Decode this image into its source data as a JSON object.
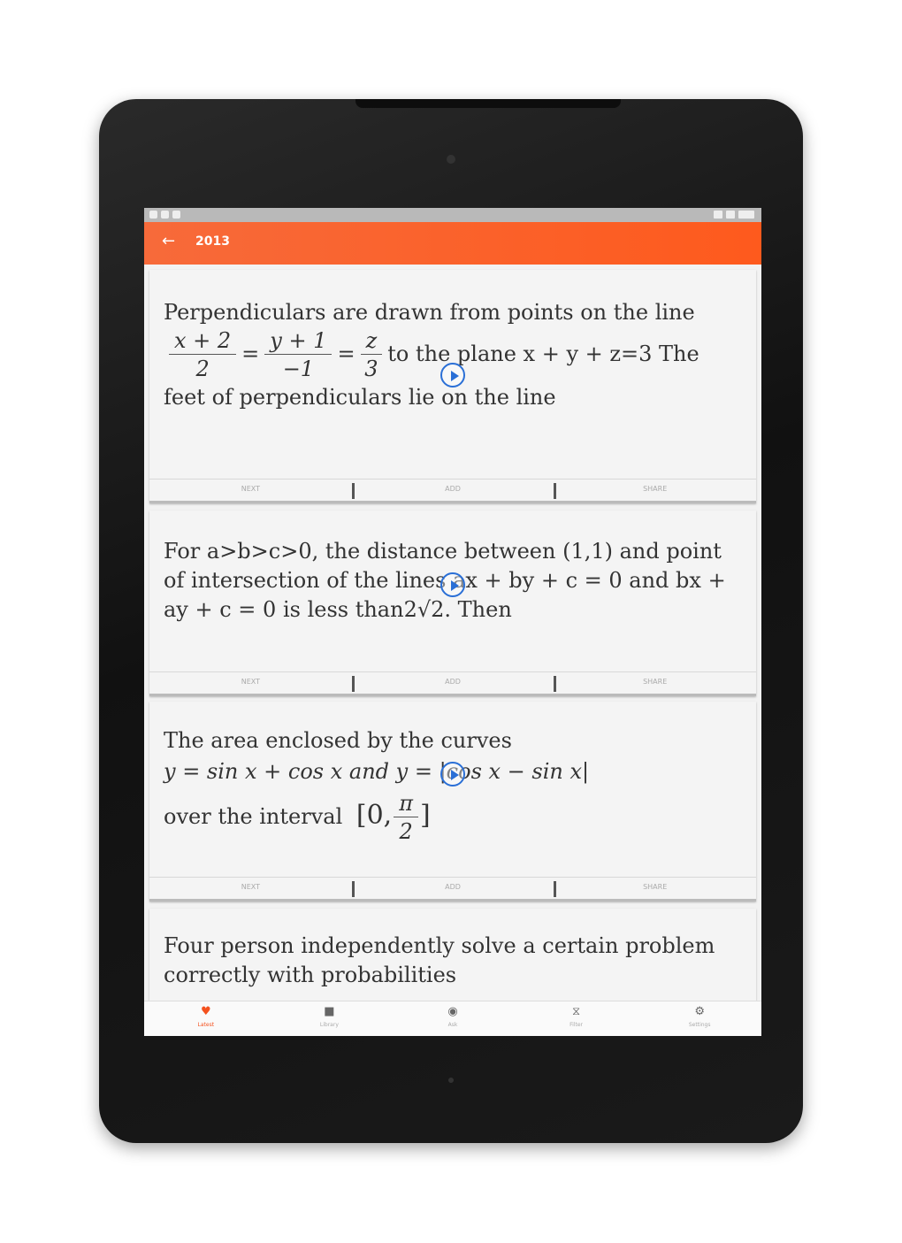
{
  "app": {
    "title": "2013"
  },
  "cards": [
    {
      "text_before": "Perpendiculars are drawn from points on the line",
      "frac1": {
        "num": "x + 2",
        "den": "2"
      },
      "eq": "=",
      "frac2": {
        "num": "y + 1",
        "den": "−1"
      },
      "eq2": "=",
      "frac3": {
        "num": "z",
        "den": "3"
      },
      "text_after": "to the plane x + y + z=3 The feet of perpendiculars lie on the line",
      "actions": [
        "NEXT",
        "ADD",
        "SHARE"
      ]
    },
    {
      "text": "For a>b>c>0, the distance between (1,1) and point of intersection of the lines ax + by + c = 0 and bx + ay + c = 0 is less than2√2. Then",
      "actions": [
        "NEXT",
        "ADD",
        "SHARE"
      ]
    },
    {
      "line1": "The area enclosed by the curves",
      "line2": "y = sin x + cos x  and  y = |cos x − sin x|",
      "line3": "over the interval",
      "interval": {
        "left": "[0,",
        "num": "π",
        "den": "2",
        "right": "]"
      },
      "actions": [
        "NEXT",
        "ADD",
        "SHARE"
      ]
    },
    {
      "text": "Four person independently solve a certain problem correctly with probabilities"
    }
  ],
  "bottom_nav": [
    {
      "icon": "heart-icon",
      "glyph": "♥",
      "label": "Latest"
    },
    {
      "icon": "book-icon",
      "glyph": "■",
      "label": "Library"
    },
    {
      "icon": "chat-icon",
      "glyph": "◉",
      "label": "Ask"
    },
    {
      "icon": "filter-icon",
      "glyph": "⧖",
      "label": "Filter"
    },
    {
      "icon": "gear-icon",
      "glyph": "⚙",
      "label": "Settings"
    }
  ],
  "colors": {
    "accent": "#fe5a1d",
    "play": "#2a6fd6"
  }
}
